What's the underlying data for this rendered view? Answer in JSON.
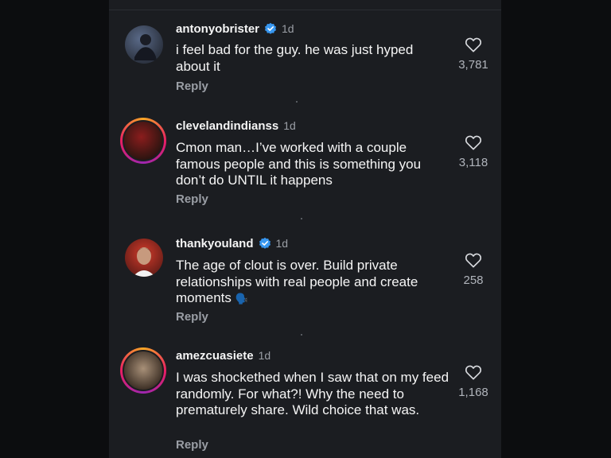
{
  "comments": [
    {
      "username": "antonyobrister",
      "verified": true,
      "age": "1d",
      "text": "i feel bad for the guy. he was just hyped about it",
      "reply": "Reply",
      "likes": "3,781",
      "avatar_colors": [
        "#5a6a88",
        "#2d3442"
      ]
    },
    {
      "username": "clevelandindianss",
      "verified": false,
      "age": "1d",
      "text": "Cmon man…I’ve worked with a couple famous people and this is something you don’t do UNTIL it happens",
      "reply": "Reply",
      "likes": "3,118",
      "avatar_colors": [
        "#8b1d1d",
        "#2a1410"
      ]
    },
    {
      "username": "thankyouland",
      "verified": true,
      "age": "1d",
      "text": "The age of clout is over. Build private relationships with real people and create moments",
      "emoji": "🗣️",
      "reply": "Reply",
      "likes": "258",
      "avatar_colors": [
        "#d23b2b",
        "#6a1e18"
      ]
    },
    {
      "username": "amezcuasiete",
      "verified": false,
      "age": "1d",
      "text": "I was shockethed when I saw that on my feed randomly. For what?! Why the need to prematurely share. Wild choice that was.",
      "reply": "Reply",
      "likes": "1,168",
      "avatar_colors": [
        "#a89078",
        "#3b2e24"
      ]
    }
  ],
  "colors": {
    "background": "#1b1d21",
    "verified_blue": "#3897f0"
  }
}
